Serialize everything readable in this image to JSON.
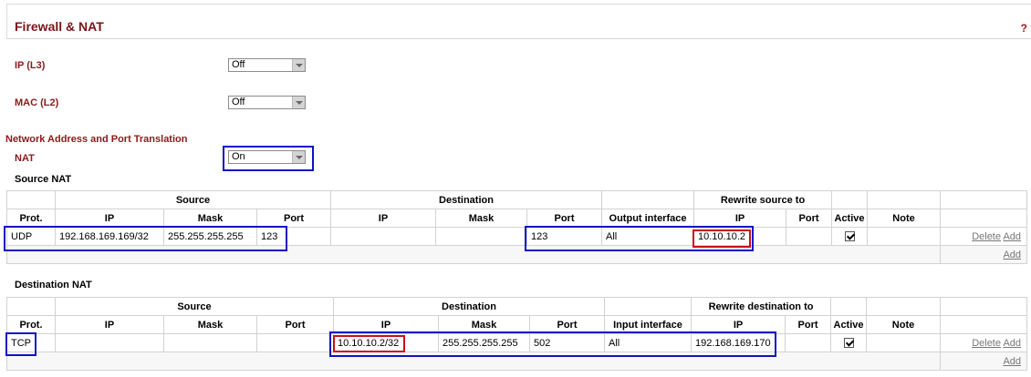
{
  "page": {
    "title": "Firewall & NAT",
    "help": "?"
  },
  "filters": {
    "ip_label": "IP (L3)",
    "ip_value": "Off",
    "mac_label": "MAC (L2)",
    "mac_value": "Off"
  },
  "napt": {
    "heading": "Network Address and Port Translation",
    "nat_label": "NAT",
    "nat_value": "On"
  },
  "snat": {
    "title": "Source NAT",
    "groups": {
      "source": "Source",
      "destination": "Destination",
      "rewrite": "Rewrite source to"
    },
    "cols": {
      "prot": "Prot.",
      "ip": "IP",
      "mask": "Mask",
      "port": "Port",
      "out_if": "Output interface",
      "active": "Active",
      "note": "Note"
    },
    "row": {
      "prot": "UDP",
      "src_ip": "192.168.169.169/32",
      "src_mask": "255.255.255.255",
      "src_port": "123",
      "dst_ip": "",
      "dst_mask": "",
      "dst_port": "123",
      "out_if": "All",
      "rw_ip": "10.10.10.2",
      "rw_port": "",
      "note": ""
    },
    "delete": "Delete",
    "add": "Add",
    "add_new": "Add"
  },
  "dnat": {
    "title": "Destination NAT",
    "groups": {
      "source": "Source",
      "destination": "Destination",
      "rewrite": "Rewrite destination to"
    },
    "cols": {
      "prot": "Prot.",
      "ip": "IP",
      "mask": "Mask",
      "port": "Port",
      "in_if": "Input interface",
      "active": "Active",
      "note": "Note"
    },
    "row": {
      "prot": "TCP",
      "src_ip": "",
      "src_mask": "",
      "src_port": "",
      "dst_ip": "10.10.10.2/32",
      "dst_mask": "255.255.255.255",
      "dst_port": "502",
      "in_if": "All",
      "rw_ip": "192.168.169.170",
      "rw_port": "",
      "note": ""
    },
    "delete": "Delete",
    "add": "Add",
    "add_new": "Add"
  }
}
